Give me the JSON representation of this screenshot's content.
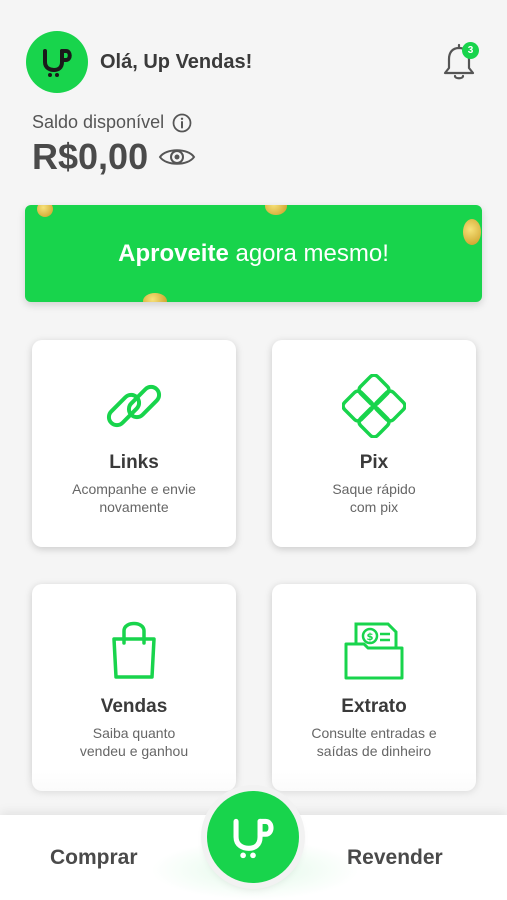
{
  "header": {
    "greeting": "Olá, Up Vendas!",
    "notification_count": "3"
  },
  "balance": {
    "label": "Saldo disponível",
    "amount": "R$0,00"
  },
  "banner": {
    "bold": "Aproveite",
    "rest": " agora mesmo!"
  },
  "cards": [
    {
      "title": "Links",
      "desc": "Acompanhe e envie\nnovamente",
      "icon": "link-icon"
    },
    {
      "title": "Pix",
      "desc": "Saque rápido\ncom pix",
      "icon": "pix-icon"
    },
    {
      "title": "Vendas",
      "desc": "Saiba quanto\nvendeu e ganhou",
      "icon": "shopping-bag-icon"
    },
    {
      "title": "Extrato",
      "desc": "Consulte entradas e\nsaídas de dinheiro",
      "icon": "statement-folder-icon"
    }
  ],
  "bottom_nav": {
    "left": "Comprar",
    "right": "Revender"
  },
  "colors": {
    "accent": "#18d44c",
    "text_dark": "#3a3a3a"
  }
}
